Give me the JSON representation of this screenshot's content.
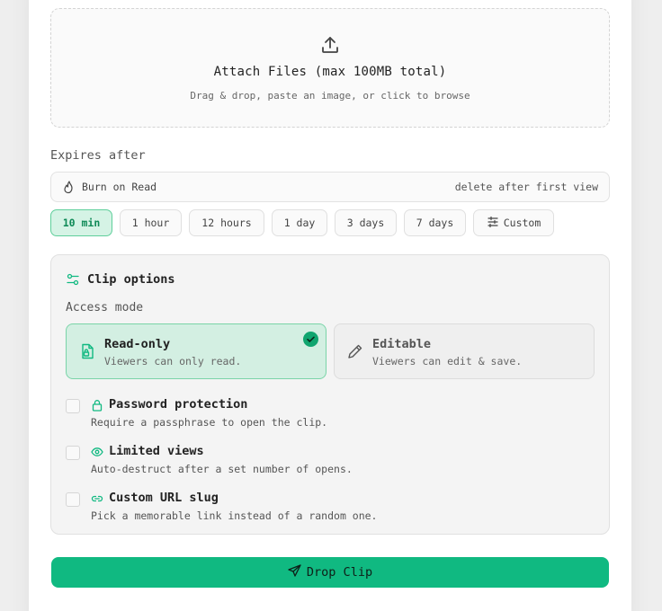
{
  "dropzone": {
    "icon": "upload-icon",
    "title": "Attach Files (max 100MB total)",
    "subtitle": "Drag & drop, paste an image, or click to browse"
  },
  "expires": {
    "label": "Expires after",
    "burn": {
      "icon": "flame-icon",
      "label": "Burn on Read",
      "hint": "delete after first view"
    },
    "chips": [
      {
        "label": "10 min",
        "active": true
      },
      {
        "label": "1 hour",
        "active": false
      },
      {
        "label": "12 hours",
        "active": false
      },
      {
        "label": "1 day",
        "active": false
      },
      {
        "label": "3 days",
        "active": false
      },
      {
        "label": "7 days",
        "active": false
      },
      {
        "label": "Custom",
        "active": false,
        "icon": "sliders-icon"
      }
    ]
  },
  "options": {
    "title": "Clip options",
    "icon": "settings-toggle-icon",
    "access_label": "Access mode",
    "modes": [
      {
        "title": "Read-only",
        "subtitle": "Viewers can only read.",
        "icon": "file-lock-icon",
        "selected": true
      },
      {
        "title": "Editable",
        "subtitle": "Viewers can edit & save.",
        "icon": "pencil-icon",
        "selected": false
      }
    ],
    "toggles": [
      {
        "title": "Password protection",
        "subtitle": "Require a passphrase to open the clip.",
        "icon": "lock-icon",
        "checked": false
      },
      {
        "title": "Limited views",
        "subtitle": "Auto-destruct after a set number of opens.",
        "icon": "eye-icon",
        "checked": false
      },
      {
        "title": "Custom URL slug",
        "subtitle": "Pick a memorable link instead of a random one.",
        "icon": "link-icon",
        "checked": false
      }
    ]
  },
  "submit": {
    "label": "Drop Clip",
    "icon": "send-icon"
  },
  "colors": {
    "accent": "#10b981",
    "accent_light": "#d5f3e5",
    "accent_text": "#0f8a57"
  }
}
